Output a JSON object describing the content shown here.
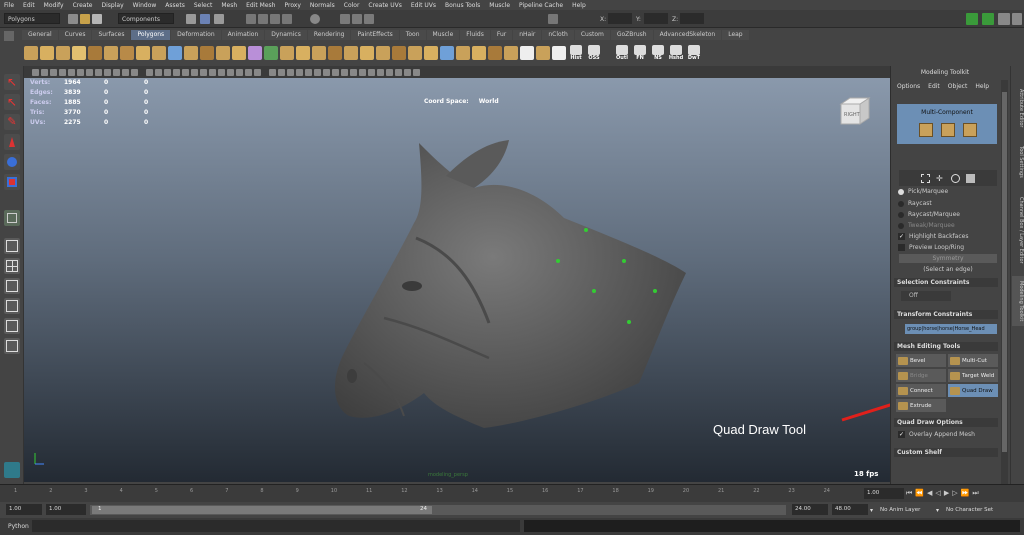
{
  "menubar": [
    "File",
    "Edit",
    "Modify",
    "Create",
    "Display",
    "Window",
    "Assets",
    "Select",
    "Mesh",
    "Edit Mesh",
    "Proxy",
    "Normals",
    "Color",
    "Create UVs",
    "Edit UVs",
    "Bonus Tools",
    "Muscle",
    "Pipeline Cache",
    "Help"
  ],
  "status_line": {
    "mode": "Polygons",
    "component_mode": "Components",
    "x_label": "X:",
    "y_label": "Y:",
    "z_label": "Z:"
  },
  "shelf_tabs": [
    "General",
    "Curves",
    "Surfaces",
    "Polygons",
    "Deformation",
    "Animation",
    "Dynamics",
    "Rendering",
    "PaintEffects",
    "Toon",
    "Muscle",
    "Fluids",
    "Fur",
    "nHair",
    "nCloth",
    "Custom",
    "GoZBrush",
    "AdvancedSkeleton",
    "Leap"
  ],
  "active_shelf_tab": "Polygons",
  "shelf_labels": [
    "Hist",
    "OSS",
    "Outl",
    "FN",
    "NS",
    "Hshd",
    "DwT"
  ],
  "hud": {
    "rows": [
      {
        "label": "Verts:",
        "values": [
          "1964",
          "0",
          "0"
        ]
      },
      {
        "label": "Edges:",
        "values": [
          "3839",
          "0",
          "0"
        ]
      },
      {
        "label": "Faces:",
        "values": [
          "1885",
          "0",
          "0"
        ]
      },
      {
        "label": "Tris:",
        "values": [
          "3770",
          "0",
          "0"
        ]
      },
      {
        "label": "UVs:",
        "values": [
          "2275",
          "0",
          "0"
        ]
      }
    ],
    "coord_space_label": "Coord Space:",
    "coord_space_value": "World",
    "view_cube_label": "RIGHT",
    "fps": "18 fps",
    "camera_label": "modeling_persp"
  },
  "annotation": {
    "text": "Quad Draw Tool",
    "color": "#e0201b"
  },
  "modeling_toolkit": {
    "title": "Modeling Toolkit",
    "menus": [
      "Options",
      "Edit",
      "Object",
      "Help"
    ],
    "mode_title": "Multi-Component",
    "select_modes": [
      {
        "label": "Pick/Marquee",
        "on": true
      },
      {
        "label": "Raycast",
        "on": false
      },
      {
        "label": "Raycast/Marquee",
        "on": false
      },
      {
        "label": "Tweak/Marquee",
        "on": false
      }
    ],
    "highlight_backfaces": "Highlight Backfaces",
    "preview_loop": "Preview Loop/Ring",
    "symmetry_button": "Symmetry",
    "select_hint": "(Select an edge)",
    "selection_constraints": "Selection Constraints",
    "constraint_value": "Off",
    "transform_constraints": "Transform Constraints",
    "transform_target": "group|horse|horse|Horse_Head",
    "mesh_editing_tools": "Mesh Editing Tools",
    "tools": [
      {
        "label": "Bevel"
      },
      {
        "label": "Multi-Cut"
      },
      {
        "label": "Bridge"
      },
      {
        "label": "Target Weld"
      },
      {
        "label": "Connect"
      },
      {
        "label": "Quad Draw"
      },
      {
        "label": "Extrude"
      }
    ],
    "quad_draw_options": "Quad Draw Options",
    "overlay_append_mesh": "Overlay Append Mesh",
    "custom_shelf": "Custom Shelf"
  },
  "side_tabs": [
    "Attribute Editor",
    "Tool Settings",
    "Channel Box / Layer Editor",
    "Modeling Toolkit"
  ],
  "timeline": {
    "ticks": [
      "1",
      "2",
      "3",
      "4",
      "5",
      "6",
      "7",
      "8",
      "9",
      "10",
      "11",
      "12",
      "13",
      "14",
      "15",
      "16",
      "17",
      "18",
      "19",
      "20",
      "21",
      "22",
      "23",
      "24"
    ],
    "current_frame": "1.00"
  },
  "range": {
    "start": "1.00",
    "start_playback": "1.00",
    "slider_start": "1",
    "slider_end": "24",
    "end_playback": "24.00",
    "end": "48.00",
    "anim_layer": "No Anim Layer",
    "character_set": "No Character Set"
  },
  "command_line": {
    "label": "Python"
  }
}
